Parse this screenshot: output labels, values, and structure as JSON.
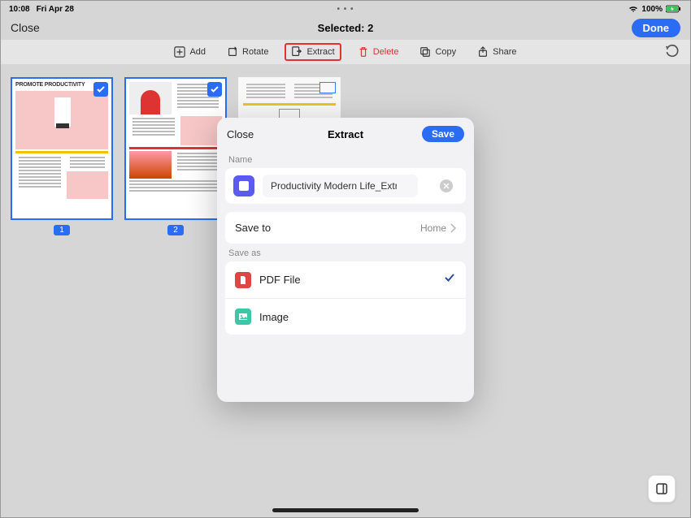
{
  "statusbar": {
    "time": "10:08",
    "date": "Fri Apr 28",
    "battery": "100%"
  },
  "header": {
    "close": "Close",
    "title": "Selected: 2",
    "done": "Done"
  },
  "toolbar": {
    "add": "Add",
    "rotate": "Rotate",
    "extract": "Extract",
    "delete": "Delete",
    "copy": "Copy",
    "share": "Share"
  },
  "thumbs": {
    "page1_title": "PROMOTE PRODUCTIVITY",
    "page1_num": "1",
    "page2_num": "2"
  },
  "modal": {
    "close": "Close",
    "title": "Extract",
    "save": "Save",
    "name_label": "Name",
    "name_value": "Productivity Modern Life_Extract",
    "saveto_label": "Save to",
    "saveto_value": "Home",
    "saveas_label": "Save as",
    "opt_pdf": "PDF File",
    "opt_image": "Image"
  }
}
